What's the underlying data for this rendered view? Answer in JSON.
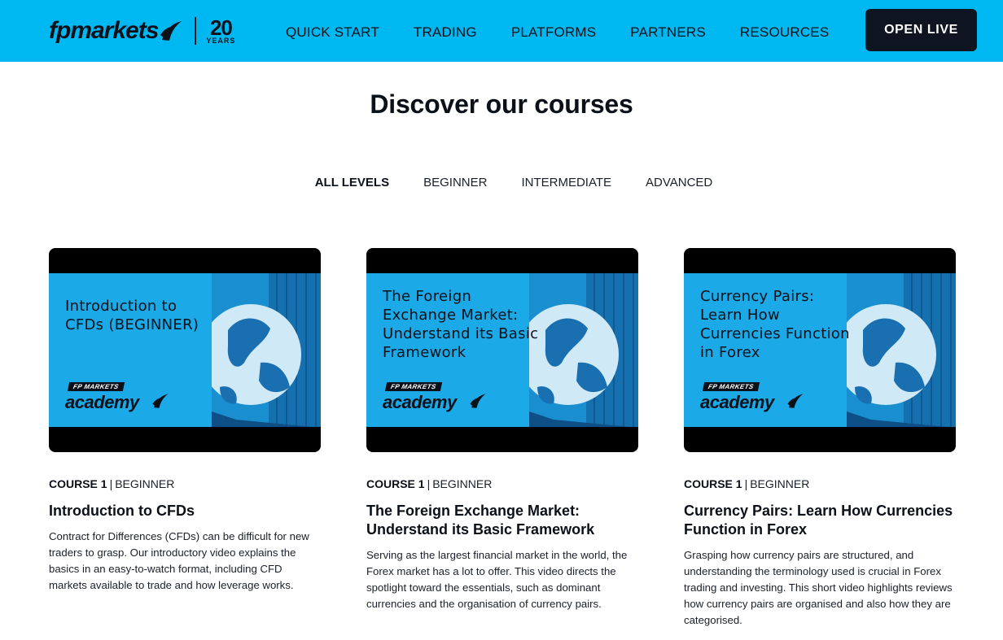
{
  "header": {
    "logo_text": "fpmarkets",
    "years_num": "20",
    "years_label": "YEARS",
    "nav": [
      "QUICK START",
      "TRADING",
      "PLATFORMS",
      "PARTNERS",
      "RESOURCES"
    ],
    "cta_label": "OPEN LIVE"
  },
  "main": {
    "title": "Discover our courses",
    "filters": [
      {
        "label": "ALL LEVELS",
        "active": true
      },
      {
        "label": "BEGINNER",
        "active": false
      },
      {
        "label": "INTERMEDIATE",
        "active": false
      },
      {
        "label": "ADVANCED",
        "active": false
      }
    ],
    "courses": [
      {
        "thumb_lines": [
          "Introduction to",
          "CFDs (BEGINNER)"
        ],
        "badge": "FP MARKETS",
        "academy": "academy",
        "course": "COURSE 1",
        "level": "BEGINNER",
        "title": "Introduction to CFDs",
        "description": "Contract for Differences (CFDs) can be difficult for new traders to grasp. Our introductory video explains the basics in an easy-to-watch format, including CFD markets available to trade and how leverage works."
      },
      {
        "thumb_lines": [
          "The Foreign",
          "Exchange Market:",
          "Understand its Basic",
          "Framework"
        ],
        "badge": "FP MARKETS",
        "academy": "academy",
        "course": "COURSE 1",
        "level": "BEGINNER",
        "title": "The Foreign Exchange Market: Understand its Basic Framework",
        "description": "Serving as the largest financial market in the world, the Forex market has a lot to offer. This video directs the spotlight toward the essentials, such as dominant currencies and the organisation of currency pairs."
      },
      {
        "thumb_lines": [
          "Currency Pairs:",
          "Learn How",
          "Currencies Function",
          "in Forex"
        ],
        "badge": "FP MARKETS",
        "academy": "academy",
        "course": "COURSE 1",
        "level": "BEGINNER",
        "title": "Currency Pairs: Learn How Currencies Function in Forex",
        "description": "Grasping how currency pairs are structured, and understanding the terminology used is crucial in Forex trading and investing. This short video highlights reviews how currency pairs are organised and also how they are categorised."
      }
    ]
  },
  "colors": {
    "header_bg": "#00b8f1",
    "cta_bg": "#0e1420",
    "thumb_bg": "#1ba9e7",
    "text": "#0c1119"
  }
}
